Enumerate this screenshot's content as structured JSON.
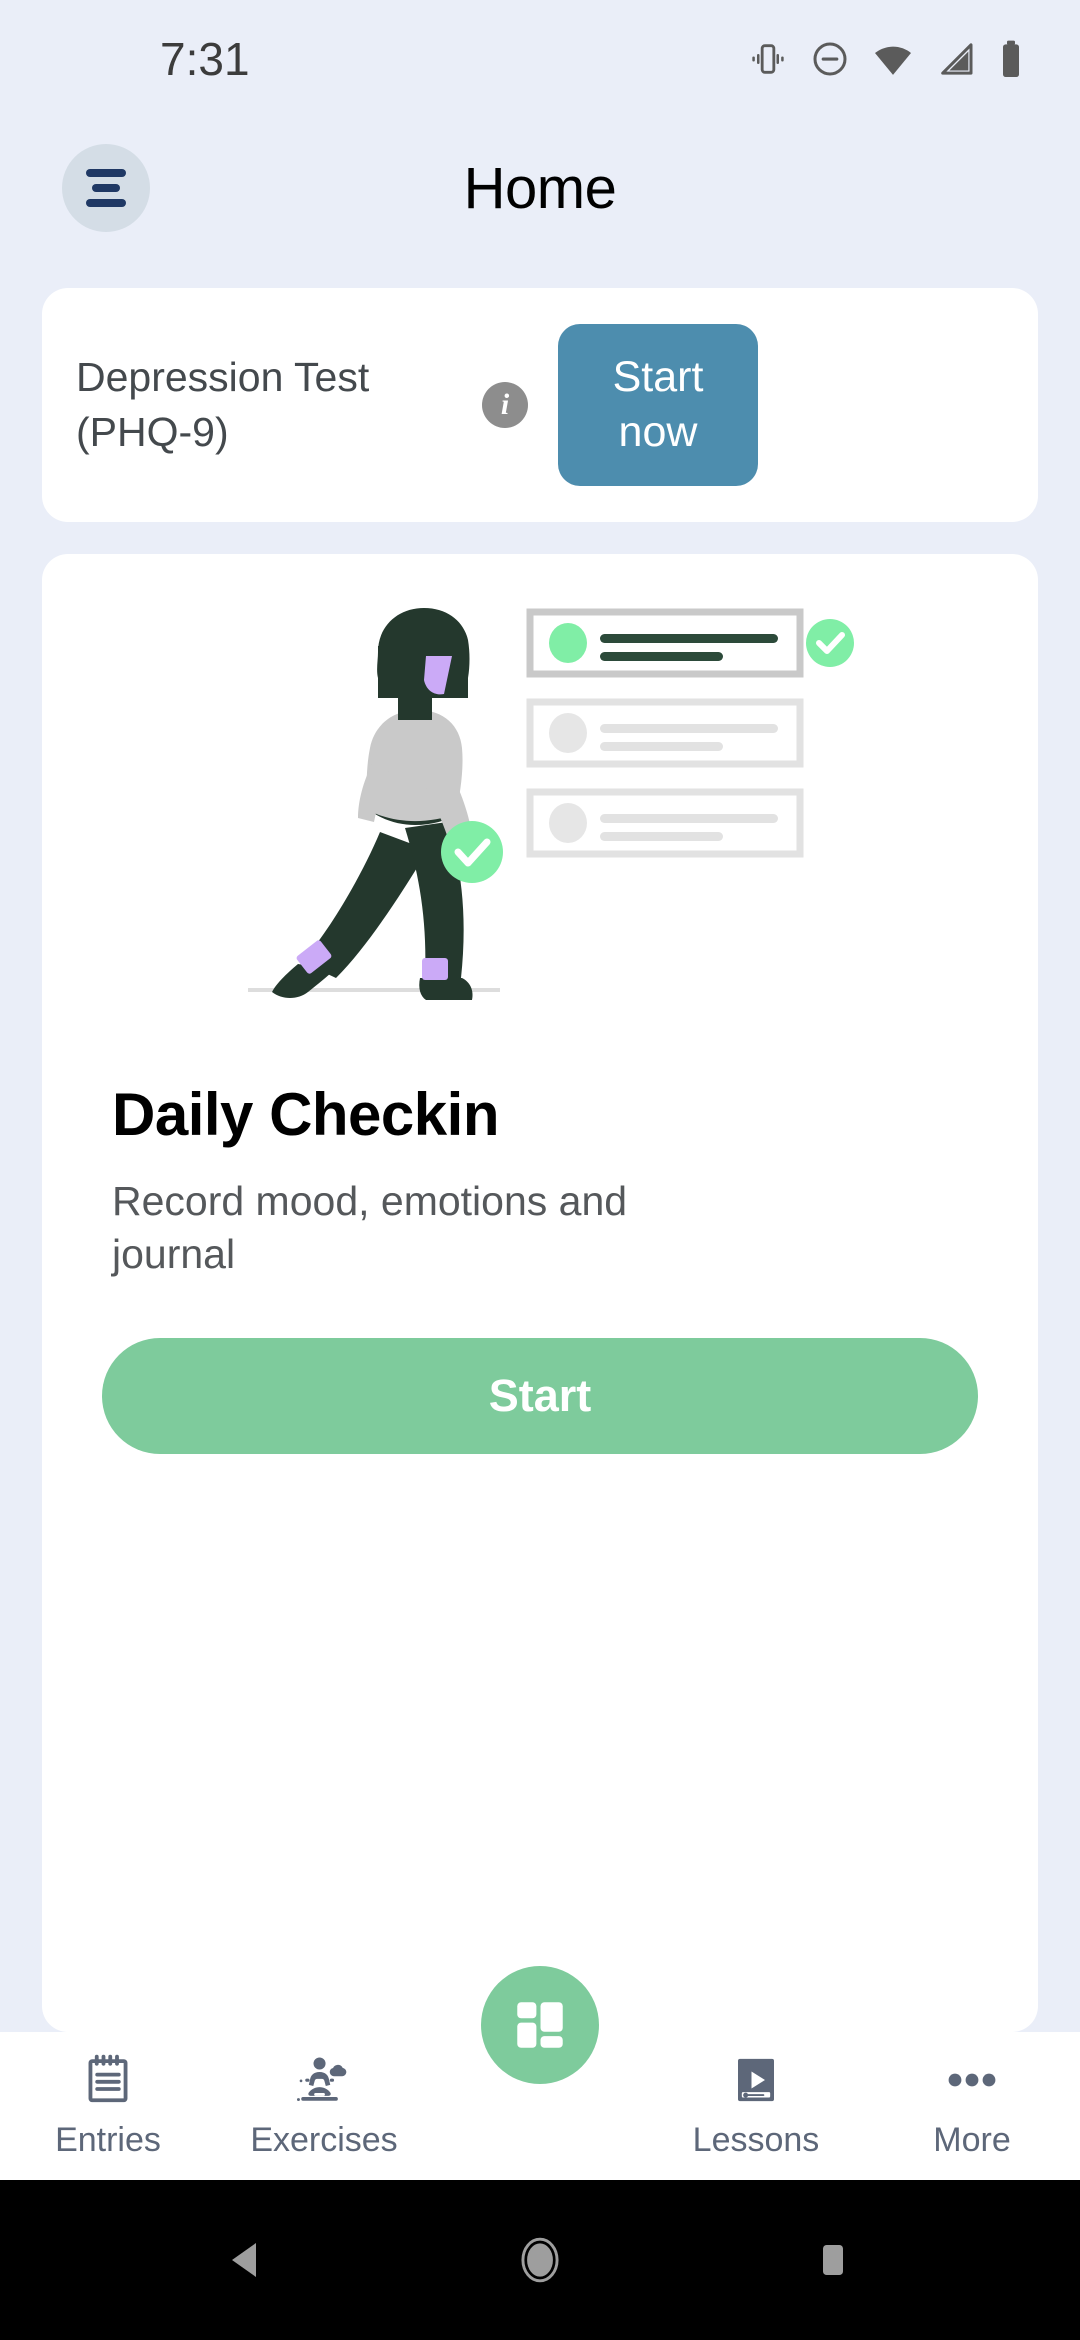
{
  "status_bar": {
    "time": "7:31",
    "icons": [
      "vibrate-icon",
      "do-not-disturb-icon",
      "wifi-icon",
      "cellular-signal-icon",
      "battery-icon"
    ]
  },
  "header": {
    "menu_icon": "hamburger-menu-icon",
    "title": "Home"
  },
  "test_card": {
    "title": "Depression Test (PHQ-9)",
    "info_icon_label": "i",
    "start_button_line1": "Start",
    "start_button_line2": "now",
    "button_color": "#4d8dae"
  },
  "checkin_card": {
    "illustration_name": "walking-person-checklist-illustration",
    "title": "Daily Checkin",
    "description": "Record mood, emotions and journal",
    "start_button": "Start",
    "button_color": "#7ecb9c"
  },
  "bottom_nav": {
    "items": [
      {
        "label": "Entries",
        "icon": "notepad-icon"
      },
      {
        "label": "Exercises",
        "icon": "meditation-icon"
      },
      {
        "label": "Lessons",
        "icon": "video-lesson-icon"
      },
      {
        "label": "More",
        "icon": "more-dots-icon"
      }
    ],
    "fab": {
      "icon": "dashboard-grid-icon",
      "color": "#7ecb9c"
    },
    "icon_color": "#5d6779"
  },
  "android_nav": {
    "buttons": [
      {
        "name": "back-button",
        "icon": "triangle-back-icon"
      },
      {
        "name": "home-button",
        "icon": "circle-home-icon"
      },
      {
        "name": "recents-button",
        "icon": "square-recents-icon"
      }
    ]
  },
  "colors": {
    "background": "#eaeef8",
    "card": "#ffffff",
    "accent_green": "#7ecb9c",
    "accent_blue": "#4d8dae",
    "nav_text": "#5d6779"
  }
}
